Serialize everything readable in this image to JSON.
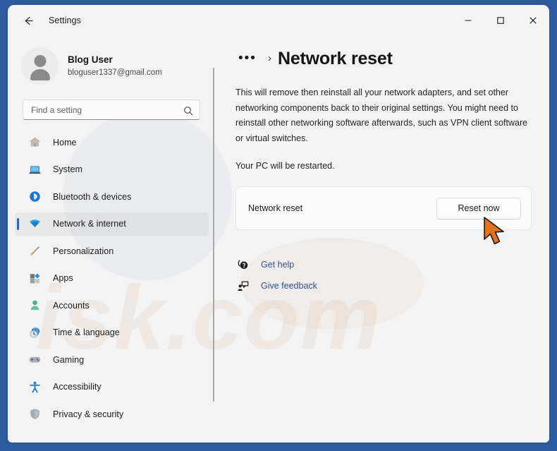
{
  "window": {
    "title": "Settings",
    "back_icon": "back-arrow-icon",
    "controls": {
      "minimize": "—",
      "maximize": "☐",
      "close": "✕"
    },
    "border_color": "#2c5a9e",
    "background_color": "#f3f3f3"
  },
  "watermark": {
    "text": "isk.com"
  },
  "sidebar": {
    "account": {
      "name": "Blog User",
      "email": "bloguser1337@gmail.com",
      "avatar_icon": "user-avatar-icon"
    },
    "search": {
      "placeholder": "Find a setting",
      "value": "",
      "icon": "search-icon"
    },
    "items": [
      {
        "label": "Home",
        "icon": "home-icon",
        "selected": false
      },
      {
        "label": "System",
        "icon": "system-laptop-icon",
        "selected": false
      },
      {
        "label": "Bluetooth & devices",
        "icon": "bluetooth-icon",
        "selected": false
      },
      {
        "label": "Network & internet",
        "icon": "wifi-icon",
        "selected": true
      },
      {
        "label": "Personalization",
        "icon": "paintbrush-icon",
        "selected": false
      },
      {
        "label": "Apps",
        "icon": "apps-icon",
        "selected": false
      },
      {
        "label": "Accounts",
        "icon": "accounts-person-icon",
        "selected": false
      },
      {
        "label": "Time & language",
        "icon": "clock-globe-icon",
        "selected": false
      },
      {
        "label": "Gaming",
        "icon": "gamepad-icon",
        "selected": false
      },
      {
        "label": "Accessibility",
        "icon": "accessibility-icon",
        "selected": false
      },
      {
        "label": "Privacy & security",
        "icon": "shield-icon",
        "selected": false
      }
    ],
    "accent_color": "#2f64c8"
  },
  "main": {
    "breadcrumb": {
      "ellipsis": "•••",
      "separator": "›"
    },
    "title": "Network reset",
    "description": "This will remove then reinstall all your network adapters, and set other networking components back to their original settings. You might need to reinstall other networking software afterwards, such as VPN client software or virtual switches.",
    "restart_note": "Your PC will be restarted.",
    "card": {
      "label": "Network reset",
      "button_label": "Reset now"
    },
    "links": [
      {
        "label": "Get help",
        "icon": "help-question-icon"
      },
      {
        "label": "Give feedback",
        "icon": "feedback-person-icon"
      }
    ],
    "link_color": "#2f5496"
  },
  "cursor": {
    "icon": "arrow-pointer-icon",
    "color": "#e0731f"
  }
}
